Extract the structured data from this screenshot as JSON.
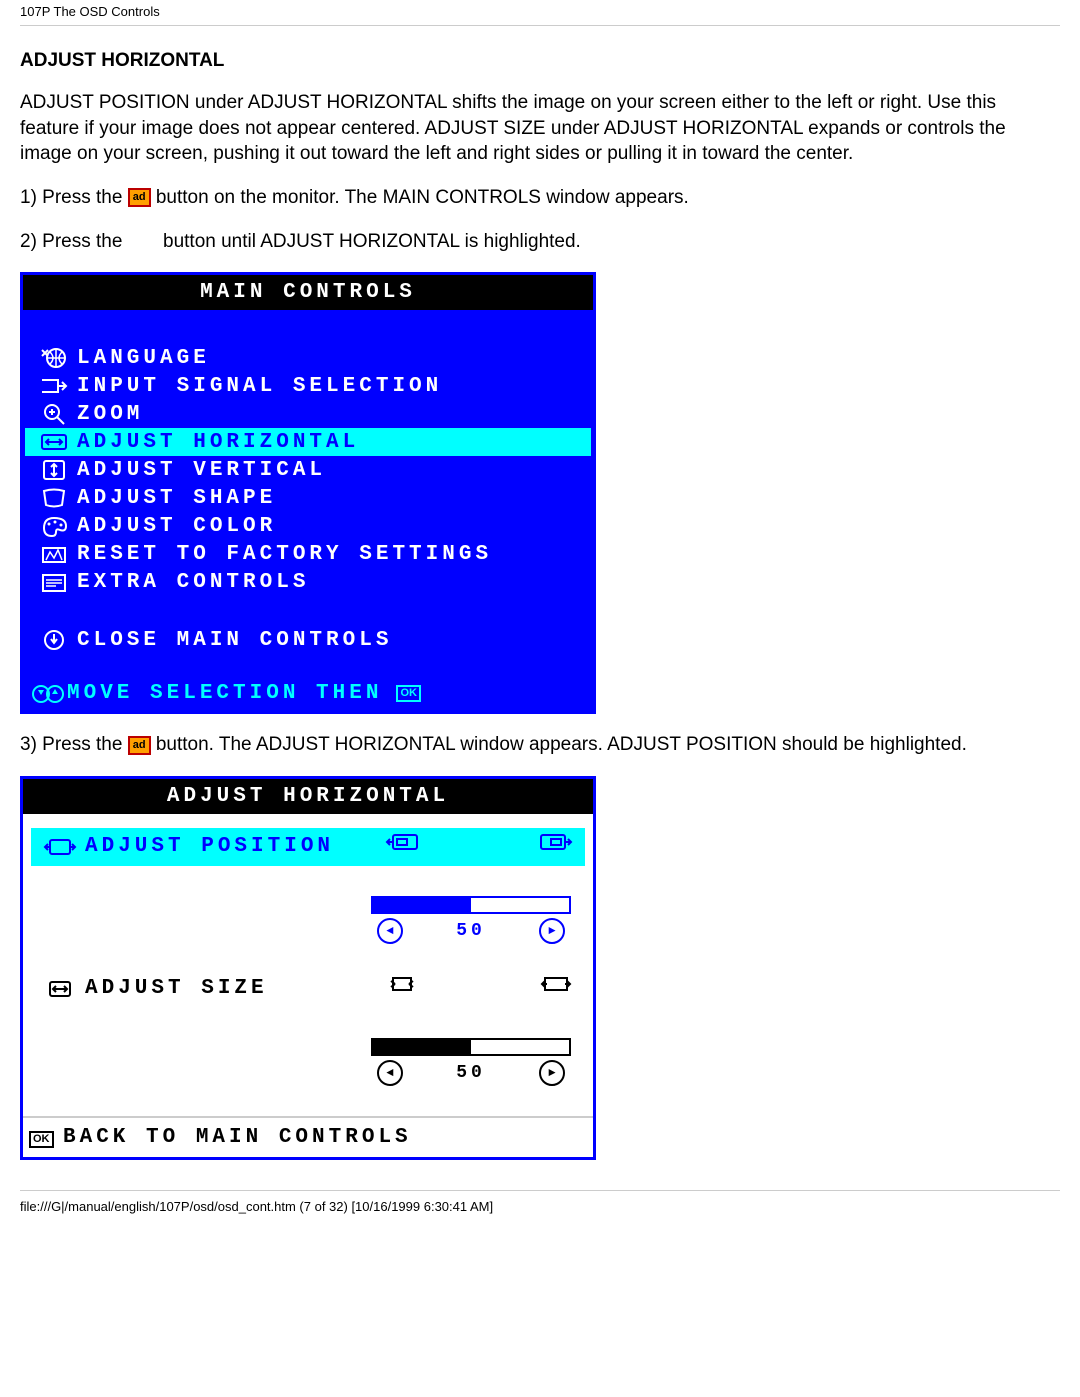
{
  "header": {
    "path": "107P The OSD Controls"
  },
  "section_title": "ADJUST HORIZONTAL",
  "intro": "ADJUST POSITION under ADJUST HORIZONTAL shifts the image on your screen either to the left or right. Use this feature if your image does not appear centered. ADJUST SIZE under ADJUST HORIZONTAL expands or controls the image on your screen, pushing it out toward the left and right sides or pulling it in toward the center.",
  "steps": {
    "s1_pre": "1) Press the ",
    "s1_icon": "ad",
    "s1_post": " button on the monitor. The MAIN CONTROLS window appears.",
    "s2_pre": "2) Press the ",
    "s2_post": " button until ADJUST HORIZONTAL is highlighted.",
    "s3_pre": "3) Press the ",
    "s3_icon": "ad",
    "s3_post": " button. The ADJUST HORIZONTAL window appears. ADJUST POSITION should be highlighted."
  },
  "osd_main": {
    "title": "MAIN CONTROLS",
    "items": [
      {
        "icon": "globe-icon",
        "label": "LANGUAGE"
      },
      {
        "icon": "input-icon",
        "label": "INPUT SIGNAL SELECTION"
      },
      {
        "icon": "zoom-icon",
        "label": "ZOOM"
      },
      {
        "icon": "horiz-icon",
        "label": "ADJUST HORIZONTAL",
        "highlighted": true
      },
      {
        "icon": "vert-icon",
        "label": "ADJUST VERTICAL"
      },
      {
        "icon": "shape-icon",
        "label": "ADJUST SHAPE"
      },
      {
        "icon": "color-icon",
        "label": "ADJUST COLOR"
      },
      {
        "icon": "reset-icon",
        "label": "RESET TO FACTORY SETTINGS"
      },
      {
        "icon": "extra-icon",
        "label": "EXTRA CONTROLS"
      }
    ],
    "close": {
      "label": "CLOSE MAIN CONTROLS"
    },
    "footer": {
      "label": "MOVE SELECTION THEN"
    }
  },
  "osd_adjust": {
    "title": "ADJUST HORIZONTAL",
    "position": {
      "label": "ADJUST POSITION",
      "value": "50",
      "highlighted": true
    },
    "size": {
      "label": "ADJUST SIZE",
      "value": "50"
    },
    "footer": {
      "label": "BACK TO MAIN CONTROLS"
    }
  },
  "footer": {
    "path": "file:///G|/manual/english/107P/osd/osd_cont.htm (7 of 32) [10/16/1999 6:30:41 AM]"
  }
}
